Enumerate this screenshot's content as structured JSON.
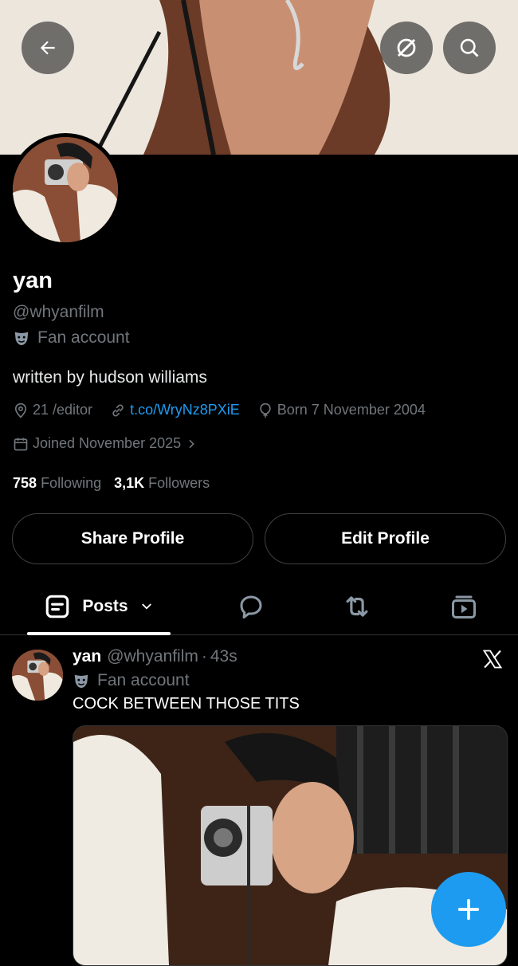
{
  "profile": {
    "name": "yan",
    "handle": "@whyanfilm",
    "label": "Fan account",
    "bio": "written by hudson williams",
    "location": "21 /editor",
    "link": "t.co/WryNz8PXiE",
    "birthday": "Born 7 November 2004",
    "joined": "Joined November 2025",
    "following_count": "758",
    "following_label": "Following",
    "followers_count": "3,1K",
    "followers_label": "Followers"
  },
  "buttons": {
    "share": "Share Profile",
    "edit": "Edit Profile"
  },
  "tabs": {
    "posts": "Posts"
  },
  "post": {
    "name": "yan",
    "handle": "@whyanfilm",
    "dot": "·",
    "time": "43s",
    "label": "Fan account",
    "text": "COCK BETWEEN THOSE TITS"
  },
  "icons": {
    "back": "back-arrow-icon",
    "grok": "grok-icon",
    "search": "search-icon",
    "location": "location-pin-icon",
    "link": "link-icon",
    "birthday": "balloon-icon",
    "calendar": "calendar-icon",
    "posts": "posts-icon",
    "replies": "reply-icon",
    "repost": "repost-icon",
    "media": "media-icon",
    "x_logo": "x-logo-icon",
    "compose": "plus-icon"
  },
  "colors": {
    "accent": "#1d9bf0",
    "muted": "#71767b",
    "background": "#000000"
  }
}
